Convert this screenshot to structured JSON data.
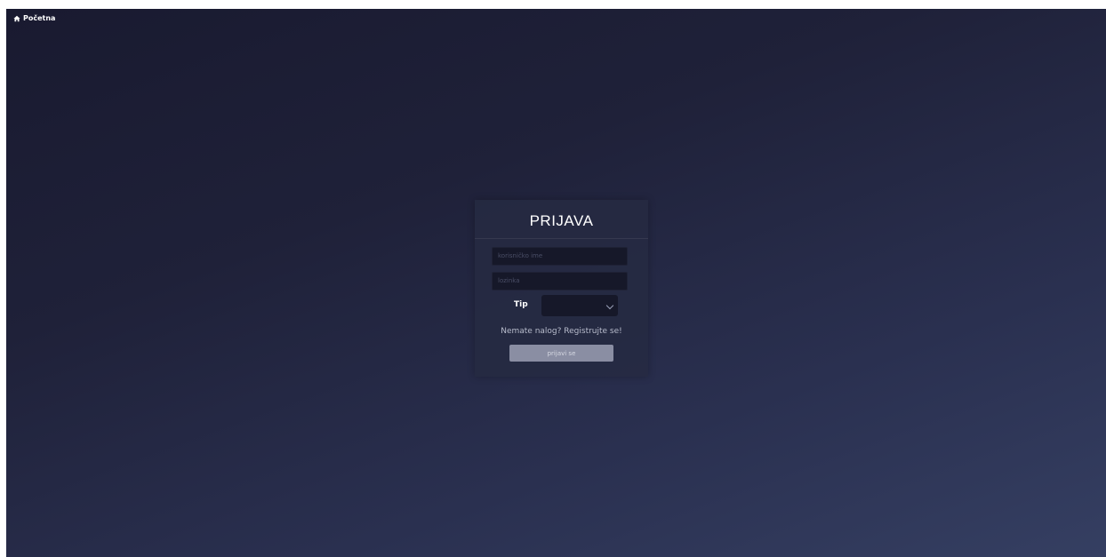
{
  "nav": {
    "home_label": "Početna",
    "home_icon": "home-icon"
  },
  "login": {
    "title": "PRIJAVA",
    "username_placeholder": "korisničko ime",
    "password_placeholder": "lozinka",
    "type_label": "Tip",
    "type_selected": "",
    "register_text": "Nemate nalog? Registrujte se!",
    "submit_label": "prijavi se"
  },
  "colors": {
    "background_start": "#191a30",
    "background_end": "#353f62",
    "card": "#262a42",
    "input": "#161829",
    "button": "#8a8ea3"
  }
}
